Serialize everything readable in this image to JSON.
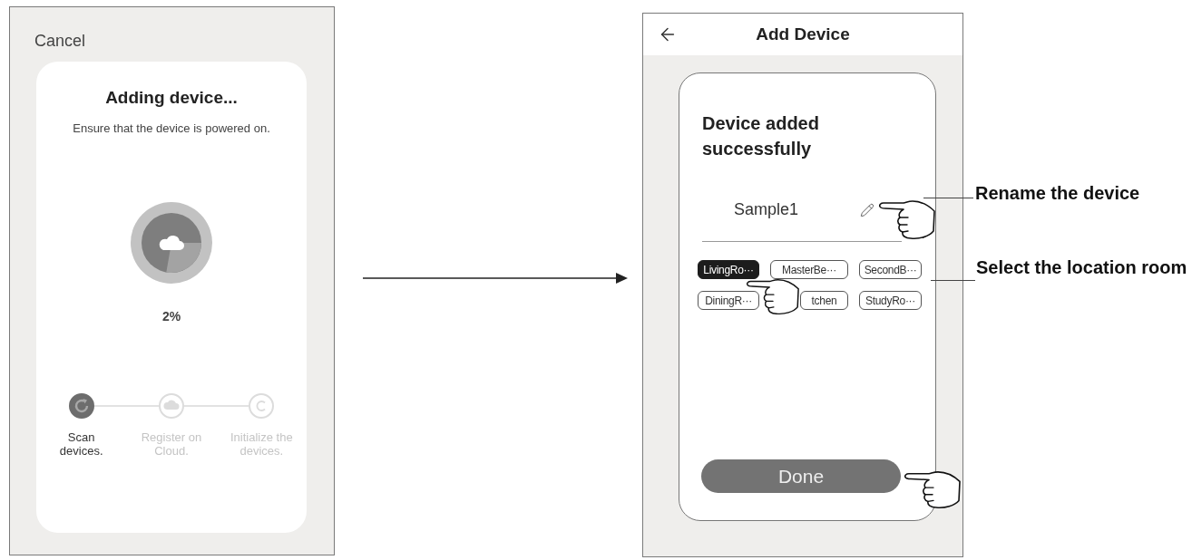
{
  "adding_screen": {
    "cancel": "Cancel",
    "title": "Adding device...",
    "subtitle": "Ensure that the device is powered on.",
    "progress": "2%",
    "steps": [
      {
        "kind": "scan",
        "label": "Scan devices.",
        "active": true
      },
      {
        "kind": "cloud",
        "label": "Register on Cloud.",
        "active": false
      },
      {
        "kind": "initialize",
        "label": "Initialize the devices.",
        "active": false
      }
    ]
  },
  "added_screen": {
    "title": "Add Device",
    "heading": "Device added successfully",
    "device_name": "Sample1",
    "rooms": [
      {
        "label": "LivingRo···",
        "selected": true
      },
      {
        "label": "MasterBe···",
        "selected": false
      },
      {
        "label": "SecondB···",
        "selected": false
      },
      {
        "label": "DiningR···",
        "selected": false
      },
      {
        "label": "tchen",
        "selected": false
      },
      {
        "label": "StudyRo···",
        "selected": false
      }
    ],
    "done": "Done"
  },
  "callouts": [
    {
      "text": "Rename the device"
    },
    {
      "text": "Select the location room"
    }
  ]
}
